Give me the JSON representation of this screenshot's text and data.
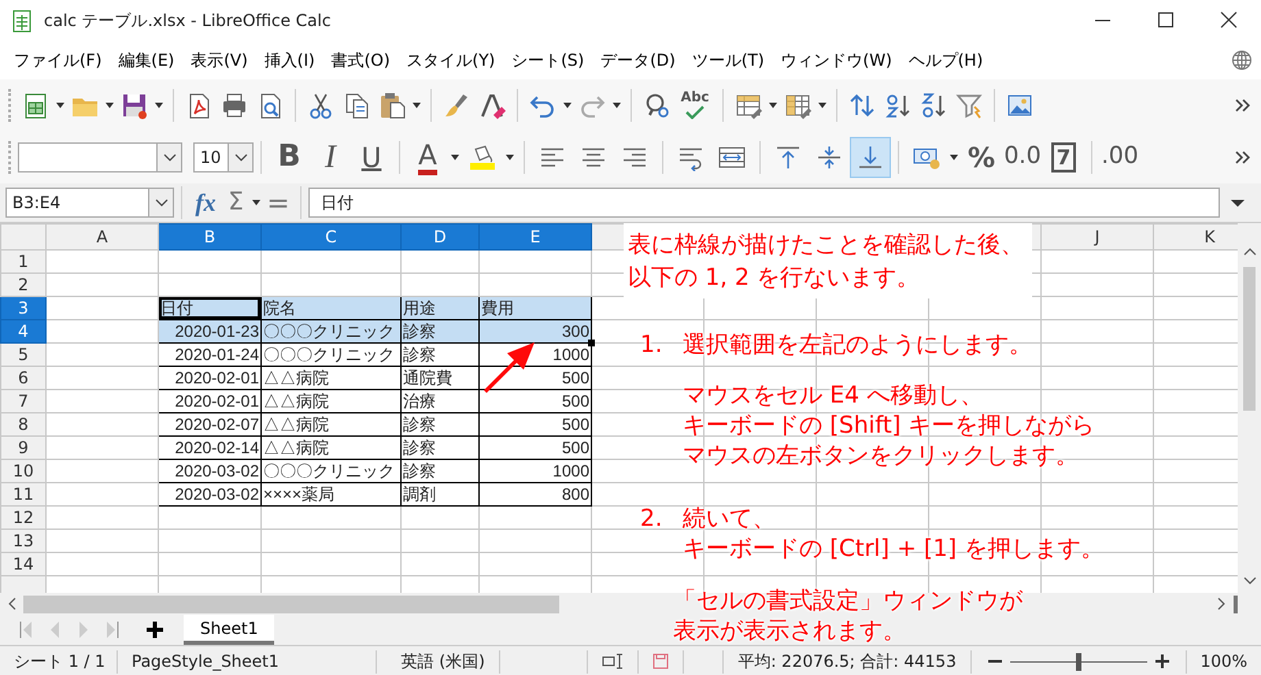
{
  "window": {
    "title": "calc テーブル.xlsx - LibreOffice Calc"
  },
  "menu": [
    {
      "label": "ファイル(F)"
    },
    {
      "label": "編集(E)"
    },
    {
      "label": "表示(V)"
    },
    {
      "label": "挿入(I)"
    },
    {
      "label": "書式(O)"
    },
    {
      "label": "スタイル(Y)"
    },
    {
      "label": "シート(S)"
    },
    {
      "label": "データ(D)"
    },
    {
      "label": "ツール(T)"
    },
    {
      "label": "ウィンドウ(W)"
    },
    {
      "label": "ヘルプ(H)"
    }
  ],
  "toolbar_1": {
    "spelling_text": "Abc"
  },
  "toolbar_2": {
    "font_size": "10",
    "groups": [
      [
        {
          "kind": "bold",
          "text": "B",
          "selected": false
        },
        {
          "kind": "italic",
          "text": "I",
          "selected": false
        },
        {
          "kind": "underline",
          "text": "U",
          "selected": false
        }
      ],
      [
        {
          "kind": "font-color",
          "text": "A",
          "selected": false
        },
        {
          "kind": "highlight",
          "selected": false
        }
      ],
      [
        {
          "kind": "align-left",
          "selected": false
        },
        {
          "kind": "align-center",
          "selected": false
        },
        {
          "kind": "align-right",
          "selected": false
        }
      ],
      [
        {
          "kind": "wrap",
          "selected": false
        },
        {
          "kind": "merge",
          "selected": false
        }
      ],
      [
        {
          "kind": "align-top",
          "selected": false
        },
        {
          "kind": "align-middle",
          "selected": false
        },
        {
          "kind": "align-bottom",
          "selected": true
        }
      ],
      [
        {
          "kind": "currency",
          "selected": false
        },
        {
          "kind": "percent",
          "text": "%",
          "selected": false
        },
        {
          "kind": "number",
          "text": "0.0",
          "selected": false
        },
        {
          "kind": "standard",
          "text": "7",
          "selected": false
        }
      ],
      [
        {
          "kind": "add-decimal",
          "text": ".00",
          "selected": false
        }
      ]
    ]
  },
  "formula_bar": {
    "name_box": "B3:E4",
    "function_wizard": "fx",
    "sum": "Σ",
    "equals": "=",
    "content": "日付"
  },
  "sheet": {
    "columns": [
      {
        "header": "A",
        "selected": false
      },
      {
        "header": "B",
        "selected": true
      },
      {
        "header": "C",
        "selected": true
      },
      {
        "header": "D",
        "selected": true
      },
      {
        "header": "E",
        "selected": true
      },
      {},
      {},
      {},
      {},
      {
        "header": "J",
        "selected": false
      },
      {
        "header": "K",
        "selected": false
      }
    ],
    "rows": [
      {
        "header": "1",
        "selected": false,
        "cells": []
      },
      {
        "header": "2",
        "selected": false,
        "cells": []
      },
      {
        "header": "3",
        "selected": true,
        "cells": [
          {},
          {
            "value": "日付",
            "kind": "text",
            "cursor": true
          },
          {
            "value": "院名",
            "kind": "text"
          },
          {
            "value": "用途",
            "kind": "text"
          },
          {
            "value": "費用",
            "kind": "text"
          }
        ]
      },
      {
        "header": "4",
        "selected": true,
        "cells": [
          {},
          {
            "value": "2020-01-23",
            "kind": "number"
          },
          {
            "value": "〇〇〇クリニック",
            "kind": "text"
          },
          {
            "value": "診察",
            "kind": "text"
          },
          {
            "value": "300",
            "kind": "number"
          }
        ]
      },
      {
        "header": "5",
        "selected": false,
        "cells": [
          {},
          {
            "value": "2020-01-24",
            "kind": "number"
          },
          {
            "value": "〇〇〇クリニック",
            "kind": "text"
          },
          {
            "value": "診察",
            "kind": "text"
          },
          {
            "value": "1000",
            "kind": "number"
          }
        ]
      },
      {
        "header": "6",
        "selected": false,
        "cells": [
          {},
          {
            "value": "2020-02-01",
            "kind": "number"
          },
          {
            "value": "△△病院",
            "kind": "text"
          },
          {
            "value": "通院費",
            "kind": "text"
          },
          {
            "value": "500",
            "kind": "number"
          }
        ]
      },
      {
        "header": "7",
        "selected": false,
        "cells": [
          {},
          {
            "value": "2020-02-01",
            "kind": "number"
          },
          {
            "value": "△△病院",
            "kind": "text"
          },
          {
            "value": "治療",
            "kind": "text"
          },
          {
            "value": "500",
            "kind": "number"
          }
        ]
      },
      {
        "header": "8",
        "selected": false,
        "cells": [
          {},
          {
            "value": "2020-02-07",
            "kind": "number"
          },
          {
            "value": "△△病院",
            "kind": "text"
          },
          {
            "value": "診察",
            "kind": "text"
          },
          {
            "value": "500",
            "kind": "number"
          }
        ]
      },
      {
        "header": "9",
        "selected": false,
        "cells": [
          {},
          {
            "value": "2020-02-14",
            "kind": "number"
          },
          {
            "value": "△△病院",
            "kind": "text"
          },
          {
            "value": "診察",
            "kind": "text"
          },
          {
            "value": "500",
            "kind": "number"
          }
        ]
      },
      {
        "header": "10",
        "selected": false,
        "cells": [
          {},
          {
            "value": "2020-03-02",
            "kind": "number"
          },
          {
            "value": "〇〇〇クリニック",
            "kind": "text"
          },
          {
            "value": "診察",
            "kind": "text"
          },
          {
            "value": "1000",
            "kind": "number"
          }
        ]
      },
      {
        "header": "11",
        "selected": false,
        "cells": [
          {},
          {
            "value": "2020-03-02",
            "kind": "number"
          },
          {
            "value": "××××薬局",
            "kind": "text"
          },
          {
            "value": "調剤",
            "kind": "text"
          },
          {
            "value": "800",
            "kind": "number"
          }
        ]
      },
      {
        "header": "12",
        "selected": false,
        "cells": []
      },
      {
        "header": "13",
        "selected": false,
        "cells": []
      },
      {
        "header": "14",
        "selected": false,
        "cells": []
      },
      {
        "selected": false,
        "cells": []
      }
    ]
  },
  "annotation": {
    "intro": [
      "表に枠線が描けたことを確認した後、",
      "以下の 1, 2 を行ないます。"
    ],
    "steps": [
      {
        "number": "1.",
        "heading": "選択範囲を左記のようにします。",
        "detail": [
          "マウスをセル E4 へ移動し、",
          "キーボードの [Shift] キーを押しながら",
          "マウスの左ボタンをクリックします。"
        ]
      },
      {
        "number": "2.",
        "heading": "続いて、",
        "detail": [
          "キーボードの [Ctrl] + [1] を押します。"
        ]
      }
    ],
    "note": [
      "「セルの書式設定」ウィンドウが",
      "表示が表示されます。"
    ]
  },
  "sheet_tabs": [
    {
      "label": "Sheet1",
      "selected": true
    }
  ],
  "status_bar": {
    "sheet": "シート 1 / 1",
    "page_style": "PageStyle_Sheet1",
    "language": "英語 (米国)",
    "summary": "平均: 22076.5; 合計: 44153",
    "zoom": {
      "level": 0.5,
      "reading": "100%"
    }
  }
}
